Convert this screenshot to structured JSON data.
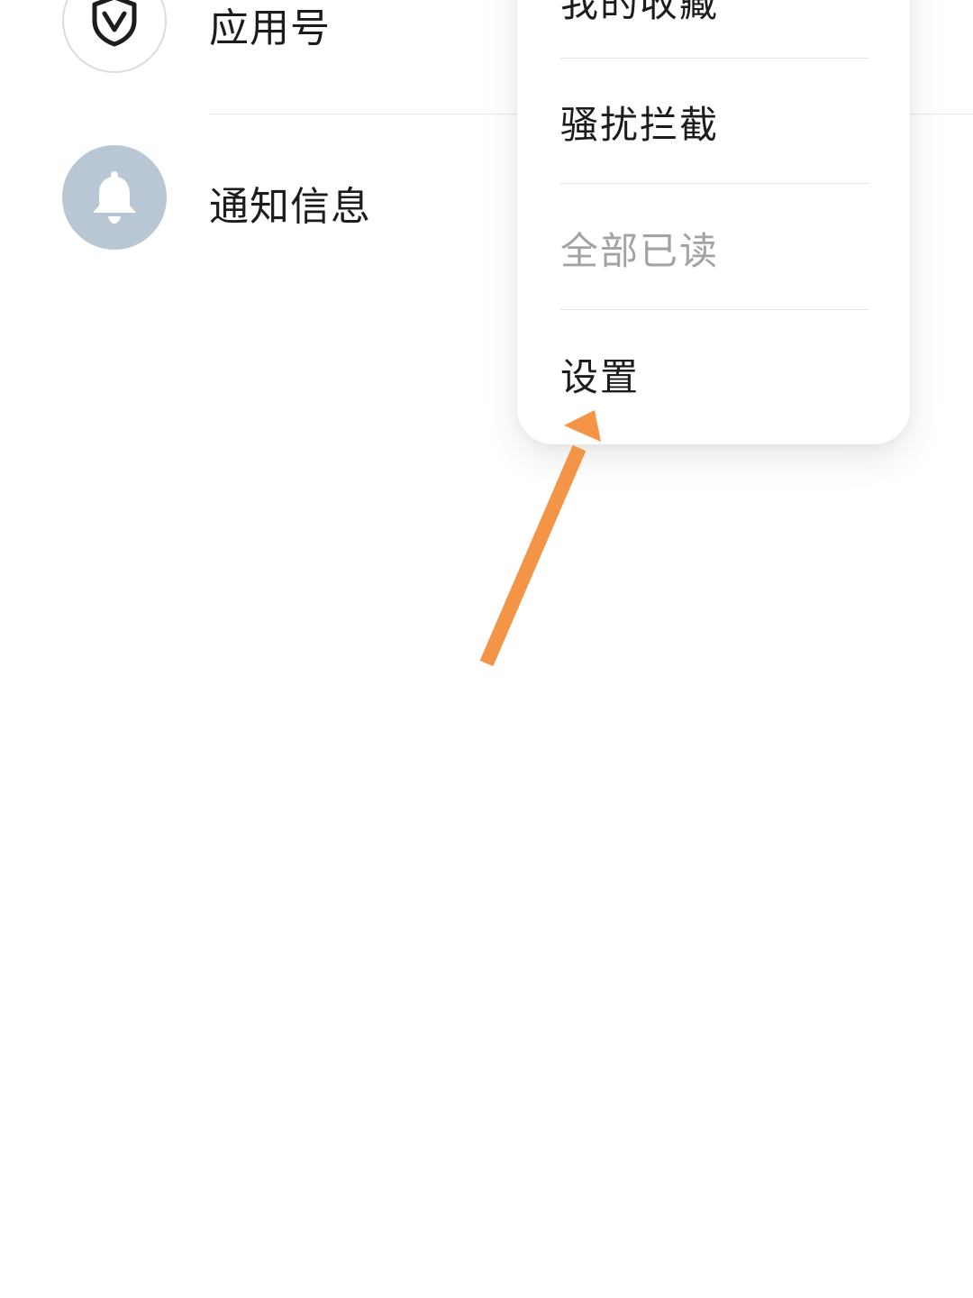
{
  "list": {
    "items": [
      {
        "label": "应用号",
        "icon": "shield-v-icon"
      },
      {
        "label": "通知信息",
        "icon": "bell-icon"
      }
    ]
  },
  "menu": {
    "items": [
      {
        "label": "我的收藏",
        "disabled": false
      },
      {
        "label": "骚扰拦截",
        "disabled": false
      },
      {
        "label": "全部已读",
        "disabled": true
      },
      {
        "label": "设置",
        "disabled": false
      }
    ]
  },
  "colors": {
    "accent_arrow": "#f39447",
    "bell_avatar_bg": "#b9c6d3",
    "disabled_text": "#a3a3a3"
  }
}
